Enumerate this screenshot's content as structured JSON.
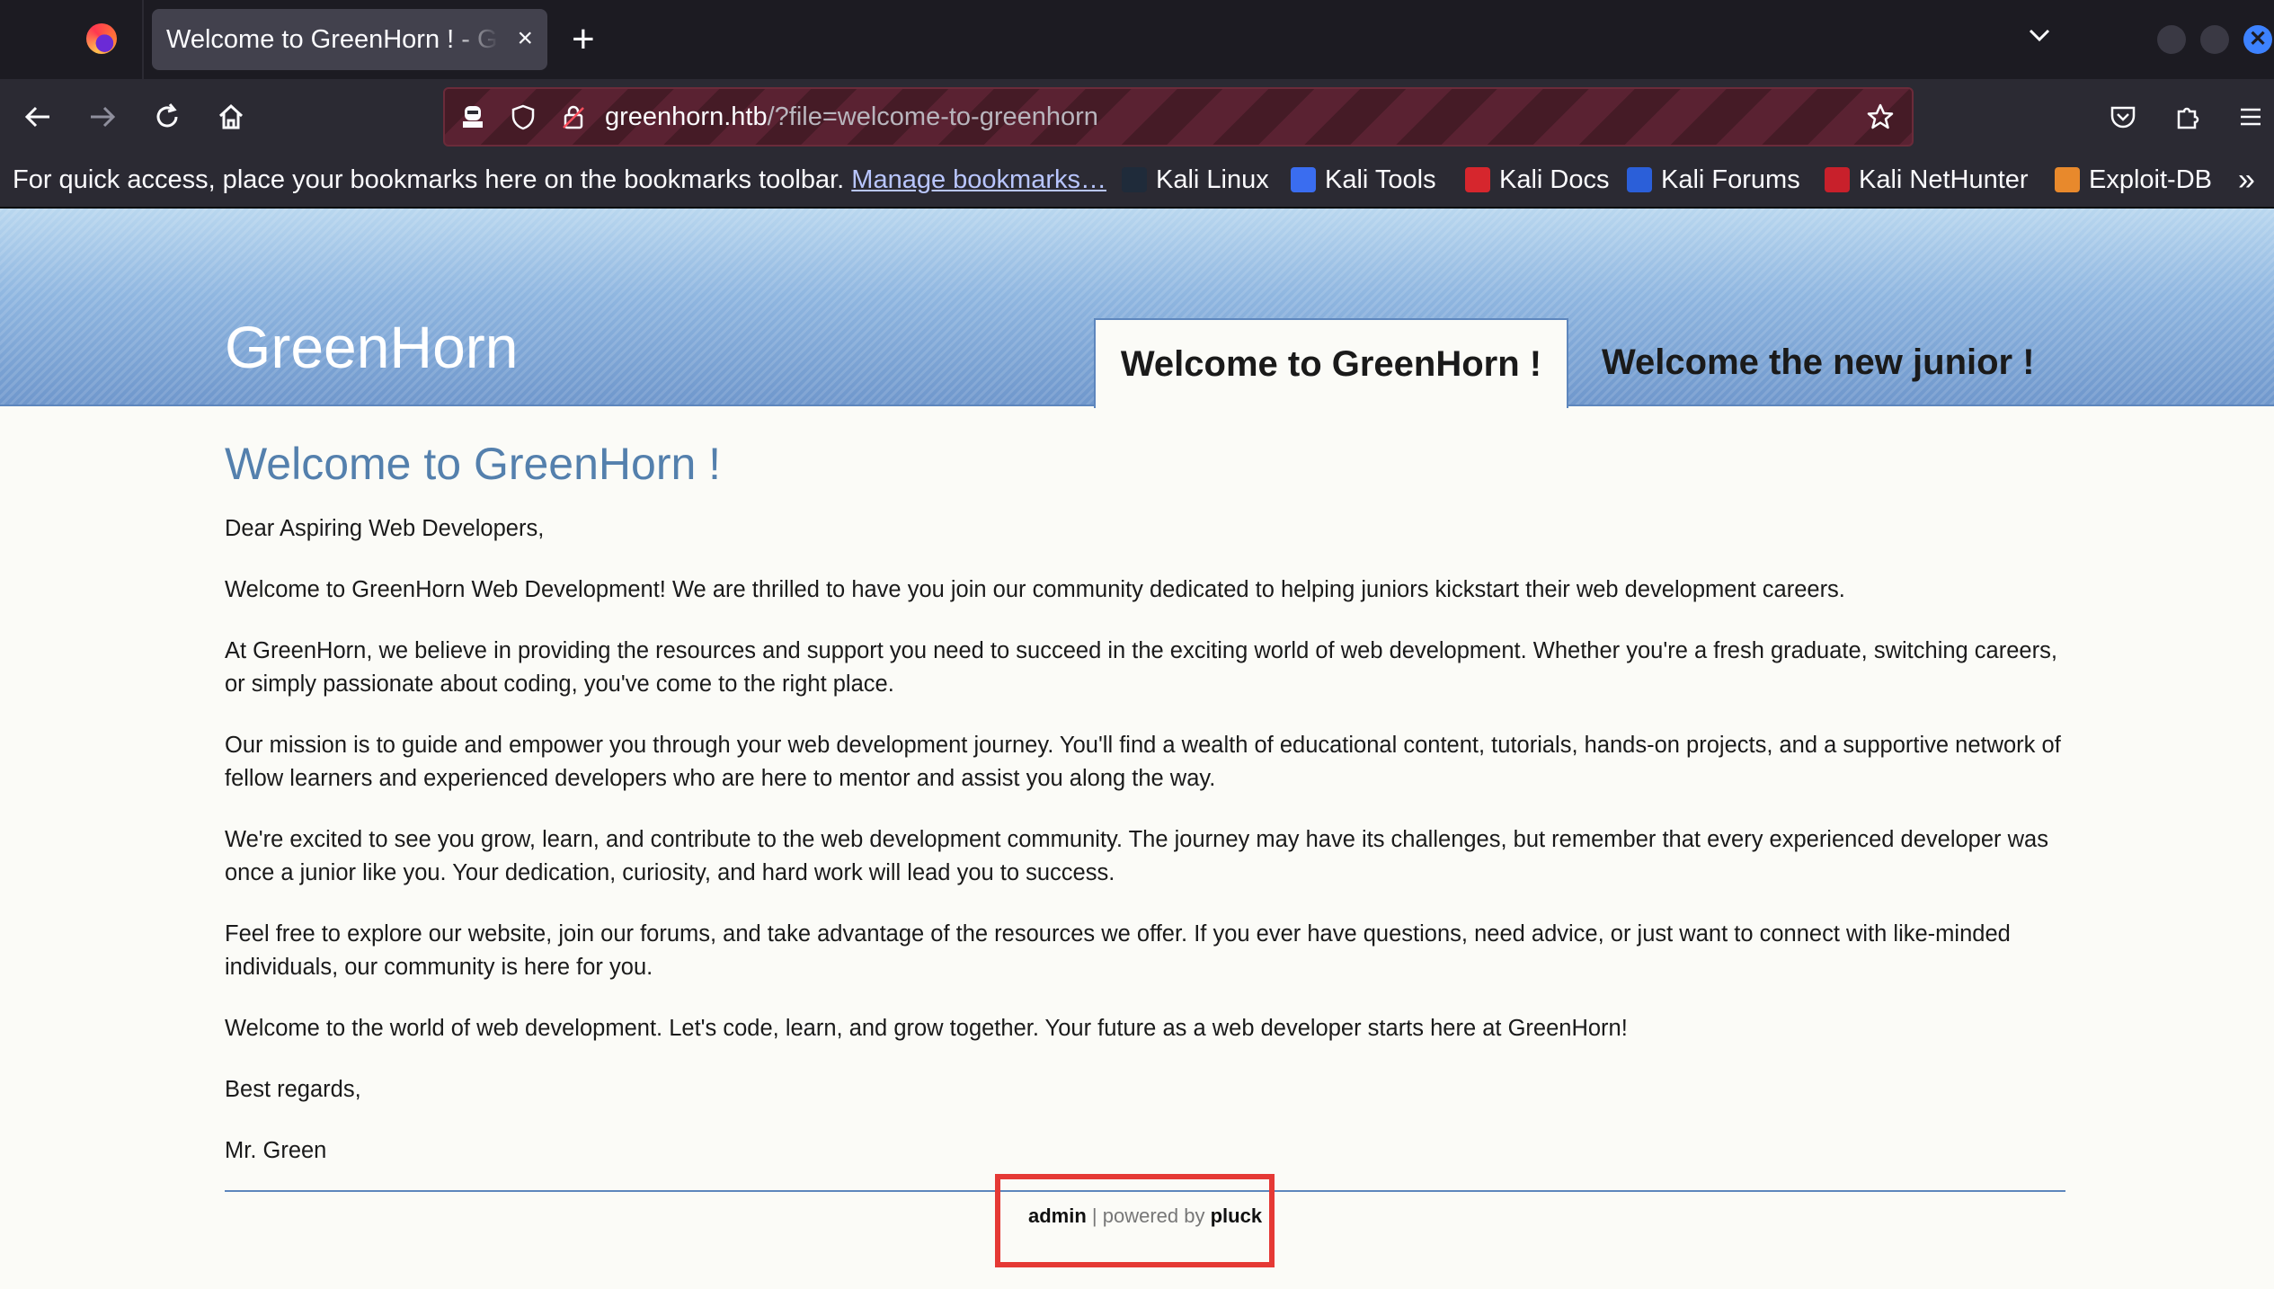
{
  "browser": {
    "tab_title": "Welcome to GreenHorn ! - GreenHorn",
    "tab_close": "×",
    "new_tab": "+",
    "url_host": "greenhorn.htb",
    "url_path": "/?file=welcome-to-greenhorn",
    "bookmarks_prompt": "For quick access, place your bookmarks here on the bookmarks toolbar.",
    "manage_bookmarks": "Manage bookmarks…",
    "bookmarks": [
      {
        "label": "Kali Linux",
        "color": "#1f2b3a"
      },
      {
        "label": "Kali Tools",
        "color": "#3a6df0"
      },
      {
        "label": "Kali Docs",
        "color": "#d6262d"
      },
      {
        "label": "Kali Forums",
        "color": "#2b5fd9"
      },
      {
        "label": "Kali NetHunter",
        "color": "#c8202b"
      },
      {
        "label": "Exploit-DB",
        "color": "#e8892c"
      }
    ],
    "more": "»"
  },
  "site": {
    "logo": "GreenHorn",
    "nav": [
      "Welcome to GreenHorn !",
      "Welcome the new junior !"
    ],
    "title": "Welcome to GreenHorn !",
    "paragraphs": [
      "Dear Aspiring Web Developers,",
      "Welcome to GreenHorn Web Development! We are thrilled to have you join our community dedicated to helping juniors kickstart their web development careers.",
      "At GreenHorn, we believe in providing the resources and support you need to succeed in the exciting world of web development. Whether you're a fresh graduate, switching careers, or simply passionate about coding, you've come to the right place.",
      "Our mission is to guide and empower you through your web development journey. You'll find a wealth of educational content, tutorials, hands-on projects, and a supportive network of fellow learners and experienced developers who are here to mentor and assist you along the way.",
      "We're excited to see you grow, learn, and contribute to the web development community. The journey may have its challenges, but remember that every experienced developer was once a junior like you. Your dedication, curiosity, and hard work will lead you to success.",
      "Feel free to explore our website, join our forums, and take advantage of the resources we offer. If you ever have questions, need advice, or just want to connect with like-minded individuals, our community is here for you.",
      "Welcome to the world of web development. Let's code, learn, and grow together. Your future as a web developer starts here at GreenHorn!",
      "Best regards,",
      "Mr. Green"
    ],
    "footer": {
      "admin": "admin",
      "sep": " | powered by ",
      "pluck": "pluck"
    }
  },
  "colors": {
    "highlight_box": "#e53935",
    "title": "#5480ad",
    "header_border": "#5d86bd"
  }
}
